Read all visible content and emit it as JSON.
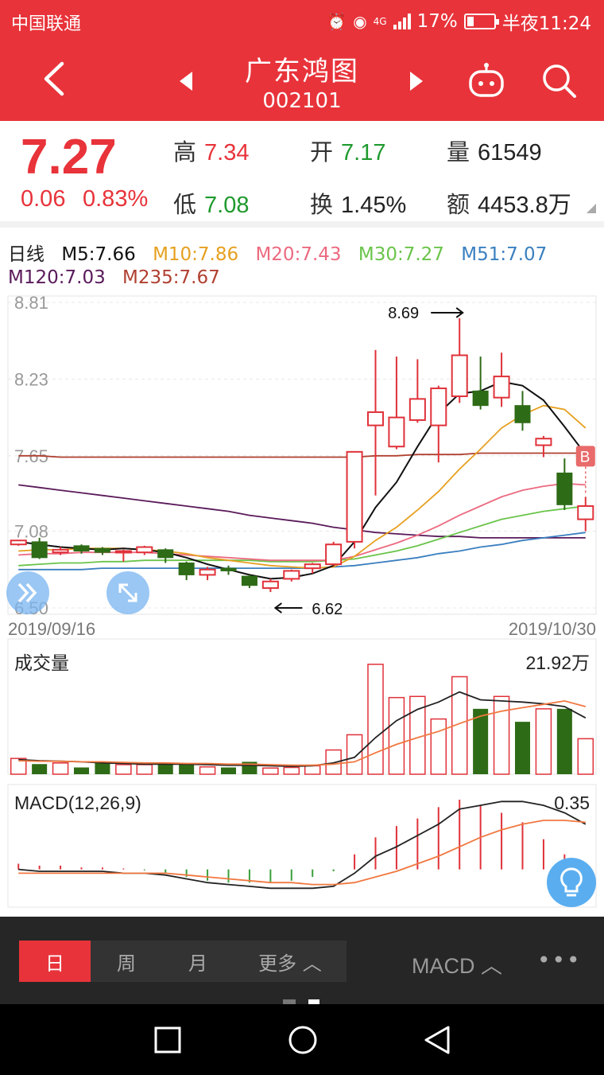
{
  "status_bar": {
    "carrier": "中国联通",
    "network": "4G",
    "battery": "17%",
    "time": "半夜11:24"
  },
  "header": {
    "stock_name": "广东鸿图",
    "stock_code": "002101"
  },
  "quote": {
    "price": "7.27",
    "change": "0.06",
    "change_pct": "0.83%",
    "high_label": "高",
    "high": "7.34",
    "open_label": "开",
    "open": "7.17",
    "volume_label": "量",
    "volume": "61549",
    "low_label": "低",
    "low": "7.08",
    "turnover_label": "换",
    "turnover": "1.45%",
    "amount_label": "额",
    "amount": "4453.8万"
  },
  "ma_legend": {
    "period": "日线",
    "m5": "M5:7.66",
    "m10": "M10:7.86",
    "m20": "M20:7.43",
    "m30": "M30:7.27",
    "m51": "M51:7.07",
    "m120": "M120:7.03",
    "m235": "M235:7.67"
  },
  "colors": {
    "brand": "#e8333a",
    "up": "#e0323a",
    "down": "#2e6b16",
    "m5": "#111111",
    "m10": "#e6a020",
    "m20": "#ec6a80",
    "m30": "#6ac44a",
    "m51": "#3a7fc0",
    "m120": "#5a1a5a",
    "m235": "#b04030"
  },
  "chart_data": [
    {
      "type": "candlestick",
      "y_ticks": [
        "8.81",
        "8.23",
        "7.65",
        "7.08",
        "6.50"
      ],
      "ylim": [
        6.5,
        8.81
      ],
      "date_start": "2019/09/16",
      "date_end": "2019/10/30",
      "annotation_high": "8.69",
      "annotation_low": "6.62",
      "marker_label": "B",
      "candles": [
        {
          "o": 6.98,
          "c": 7.01,
          "h": 7.01,
          "l": 6.97
        },
        {
          "o": 7.0,
          "c": 6.88,
          "h": 7.03,
          "l": 6.87
        },
        {
          "o": 6.92,
          "c": 6.94,
          "h": 6.96,
          "l": 6.9
        },
        {
          "o": 6.97,
          "c": 6.93,
          "h": 6.98,
          "l": 6.91
        },
        {
          "o": 6.95,
          "c": 6.92,
          "h": 6.96,
          "l": 6.9
        },
        {
          "o": 6.92,
          "c": 6.93,
          "h": 6.94,
          "l": 6.85
        },
        {
          "o": 6.92,
          "c": 6.96,
          "h": 6.97,
          "l": 6.9
        },
        {
          "o": 6.94,
          "c": 6.88,
          "h": 6.95,
          "l": 6.84
        },
        {
          "o": 6.84,
          "c": 6.75,
          "h": 6.85,
          "l": 6.71
        },
        {
          "o": 6.75,
          "c": 6.79,
          "h": 6.81,
          "l": 6.71
        },
        {
          "o": 6.8,
          "c": 6.78,
          "h": 6.82,
          "l": 6.75
        },
        {
          "o": 6.74,
          "c": 6.67,
          "h": 6.75,
          "l": 6.65
        },
        {
          "o": 6.65,
          "c": 6.7,
          "h": 6.72,
          "l": 6.62
        },
        {
          "o": 6.72,
          "c": 6.78,
          "h": 6.79,
          "l": 6.7
        },
        {
          "o": 6.8,
          "c": 6.83,
          "h": 6.84,
          "l": 6.76
        },
        {
          "o": 6.83,
          "c": 6.98,
          "h": 7.0,
          "l": 6.82
        },
        {
          "o": 7.0,
          "c": 7.68,
          "h": 7.68,
          "l": 6.95
        },
        {
          "o": 7.88,
          "c": 7.98,
          "h": 8.45,
          "l": 7.35
        },
        {
          "o": 7.72,
          "c": 7.94,
          "h": 8.4,
          "l": 7.7
        },
        {
          "o": 7.92,
          "c": 8.08,
          "h": 8.38,
          "l": 7.9
        },
        {
          "o": 7.88,
          "c": 8.16,
          "h": 8.18,
          "l": 7.6
        },
        {
          "o": 8.1,
          "c": 8.41,
          "h": 8.69,
          "l": 8.05
        },
        {
          "o": 8.14,
          "c": 8.03,
          "h": 8.4,
          "l": 8.0
        },
        {
          "o": 8.09,
          "c": 8.25,
          "h": 8.43,
          "l": 8.02
        },
        {
          "o": 8.03,
          "c": 7.9,
          "h": 8.14,
          "l": 7.84
        },
        {
          "o": 7.73,
          "c": 7.78,
          "h": 7.8,
          "l": 7.64
        },
        {
          "o": 7.52,
          "c": 7.28,
          "h": 7.63,
          "l": 7.24
        },
        {
          "o": 7.17,
          "c": 7.27,
          "h": 7.34,
          "l": 7.08
        }
      ],
      "ma": {
        "m5": [
          7.0,
          6.98,
          6.96,
          6.95,
          6.94,
          6.95,
          6.94,
          6.92,
          6.88,
          6.83,
          6.79,
          6.75,
          6.72,
          6.73,
          6.76,
          6.82,
          7.0,
          7.26,
          7.45,
          7.72,
          7.97,
          8.12,
          8.14,
          8.21,
          8.18,
          8.07,
          7.87,
          7.66
        ],
        "m10": [
          6.93,
          6.94,
          6.94,
          6.95,
          6.95,
          6.95,
          6.94,
          6.93,
          6.91,
          6.88,
          6.86,
          6.84,
          6.82,
          6.81,
          6.8,
          6.81,
          6.89,
          7.01,
          7.11,
          7.24,
          7.38,
          7.55,
          7.7,
          7.86,
          7.96,
          8.03,
          8.0,
          7.86
        ],
        "m20": [
          6.9,
          6.91,
          6.91,
          6.92,
          6.92,
          6.92,
          6.92,
          6.91,
          6.9,
          6.89,
          6.88,
          6.87,
          6.86,
          6.86,
          6.86,
          6.86,
          6.89,
          6.94,
          6.99,
          7.05,
          7.12,
          7.2,
          7.27,
          7.34,
          7.39,
          7.42,
          7.44,
          7.43
        ],
        "m30": [
          6.82,
          6.83,
          6.84,
          6.84,
          6.85,
          6.85,
          6.86,
          6.86,
          6.86,
          6.86,
          6.86,
          6.86,
          6.85,
          6.85,
          6.85,
          6.86,
          6.87,
          6.9,
          6.93,
          6.97,
          7.02,
          7.07,
          7.12,
          7.17,
          7.2,
          7.23,
          7.25,
          7.27
        ],
        "m51": [
          6.79,
          6.79,
          6.79,
          6.79,
          6.8,
          6.8,
          6.8,
          6.8,
          6.8,
          6.8,
          6.8,
          6.8,
          6.8,
          6.8,
          6.8,
          6.81,
          6.82,
          6.84,
          6.86,
          6.88,
          6.91,
          6.93,
          6.96,
          6.98,
          7.01,
          7.03,
          7.05,
          7.07
        ],
        "m120": [
          7.43,
          7.41,
          7.39,
          7.37,
          7.35,
          7.33,
          7.31,
          7.29,
          7.27,
          7.25,
          7.23,
          7.2,
          7.18,
          7.16,
          7.14,
          7.11,
          7.09,
          7.07,
          7.06,
          7.05,
          7.04,
          7.04,
          7.03,
          7.03,
          7.03,
          7.03,
          7.03,
          7.03
        ],
        "m235": [
          7.65,
          7.65,
          7.64,
          7.64,
          7.64,
          7.64,
          7.64,
          7.64,
          7.64,
          7.64,
          7.64,
          7.64,
          7.64,
          7.64,
          7.64,
          7.64,
          7.64,
          7.65,
          7.65,
          7.66,
          7.66,
          7.66,
          7.67,
          7.67,
          7.67,
          7.67,
          7.67,
          7.67
        ]
      }
    },
    {
      "type": "bar",
      "title": "成交量",
      "value_label": "21.92万",
      "ylim": [
        0,
        24
      ],
      "values": [
        2.8,
        1.8,
        2.0,
        1.2,
        2.0,
        1.7,
        1.7,
        1.8,
        1.8,
        1.3,
        1.2,
        2.2,
        1.1,
        1.2,
        1.5,
        4.3,
        7.0,
        19.5,
        13.6,
        13.8,
        9.8,
        17.3,
        11.6,
        13.8,
        9.3,
        11.6,
        11.6,
        6.3
      ],
      "ma1": [
        2.6,
        2.4,
        2.3,
        2.2,
        2.0,
        1.9,
        1.8,
        1.8,
        1.8,
        1.7,
        1.6,
        1.6,
        1.5,
        1.4,
        1.5,
        2.0,
        3.0,
        6.5,
        9.5,
        11.5,
        12.8,
        14.6,
        13.2,
        13.0,
        12.8,
        12.5,
        12.0,
        10.0
      ],
      "ma2": [
        2.4,
        2.3,
        2.3,
        2.2,
        2.2,
        2.1,
        2.0,
        2.0,
        1.9,
        1.9,
        1.8,
        1.8,
        1.7,
        1.6,
        1.6,
        1.8,
        2.2,
        3.8,
        5.3,
        6.5,
        7.6,
        9.0,
        10.3,
        11.2,
        11.8,
        12.4,
        13.0,
        12.0
      ]
    },
    {
      "type": "macd",
      "title": "MACD(12,26,9)",
      "value_label": "0.35",
      "ylim": [
        -0.2,
        0.45
      ],
      "dif": [
        0.0,
        -0.01,
        -0.01,
        -0.01,
        -0.01,
        -0.02,
        -0.02,
        -0.03,
        -0.05,
        -0.07,
        -0.08,
        -0.09,
        -0.1,
        -0.1,
        -0.1,
        -0.09,
        -0.02,
        0.07,
        0.12,
        0.18,
        0.24,
        0.32,
        0.34,
        0.36,
        0.36,
        0.34,
        0.3,
        0.24
      ],
      "dea": [
        -0.02,
        -0.02,
        -0.02,
        -0.02,
        -0.02,
        -0.02,
        -0.02,
        -0.02,
        -0.03,
        -0.04,
        -0.05,
        -0.06,
        -0.07,
        -0.07,
        -0.08,
        -0.08,
        -0.07,
        -0.04,
        -0.01,
        0.03,
        0.07,
        0.12,
        0.17,
        0.21,
        0.24,
        0.26,
        0.26,
        0.25
      ],
      "macd": [
        0.03,
        0.02,
        0.02,
        0.01,
        0.01,
        0.005,
        -0.005,
        -0.02,
        -0.04,
        -0.06,
        -0.07,
        -0.07,
        -0.07,
        -0.06,
        -0.04,
        -0.01,
        0.08,
        0.17,
        0.23,
        0.27,
        0.33,
        0.37,
        0.34,
        0.3,
        0.25,
        0.16,
        0.08,
        -0.02
      ]
    }
  ],
  "toolbar": {
    "tab_day": "日",
    "tab_week": "周",
    "tab_month": "月",
    "tab_more": "更多 ︿",
    "indicator": "MACD ︿",
    "more_dots": "•••"
  }
}
